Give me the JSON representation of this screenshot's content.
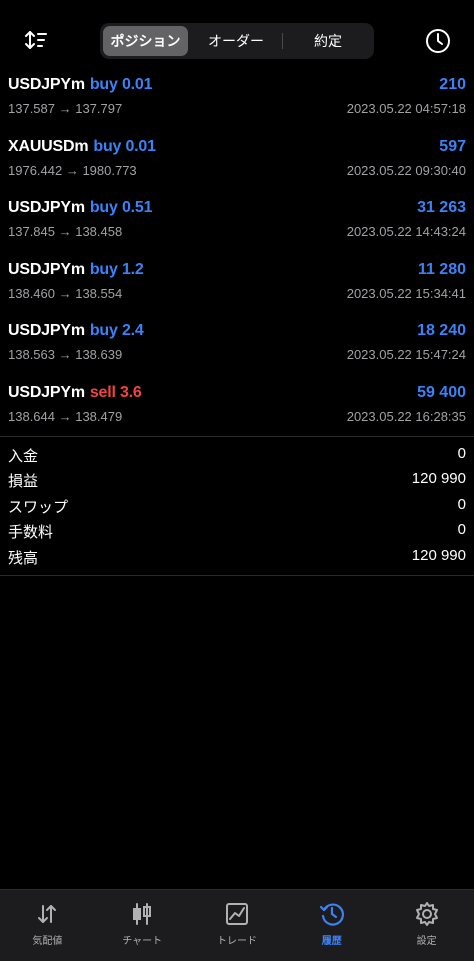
{
  "header": {
    "tabs": [
      {
        "label": "ポジション",
        "active": true
      },
      {
        "label": "オーダー",
        "active": false
      },
      {
        "label": "約定",
        "active": false
      }
    ],
    "sort_icon": "sort-arrows-icon",
    "history_icon": "clock-icon"
  },
  "deals": [
    {
      "symbol": "USDJPYm",
      "direction": "buy",
      "volume": "buy 0.01",
      "profit": "210",
      "prices": "137.587 → 137.797",
      "time": "2023.05.22 04:57:18"
    },
    {
      "symbol": "XAUUSDm",
      "direction": "buy",
      "volume": "buy 0.01",
      "profit": "597",
      "prices": "1976.442 → 1980.773",
      "time": "2023.05.22 09:30:40"
    },
    {
      "symbol": "USDJPYm",
      "direction": "buy",
      "volume": "buy 0.51",
      "profit": "31 263",
      "prices": "137.845 → 138.458",
      "time": "2023.05.22 14:43:24"
    },
    {
      "symbol": "USDJPYm",
      "direction": "buy",
      "volume": "buy 1.2",
      "profit": "11 280",
      "prices": "138.460 → 138.554",
      "time": "2023.05.22 15:34:41"
    },
    {
      "symbol": "USDJPYm",
      "direction": "buy",
      "volume": "buy 2.4",
      "profit": "18 240",
      "prices": "138.563 → 138.639",
      "time": "2023.05.22 15:47:24"
    },
    {
      "symbol": "USDJPYm",
      "direction": "sell",
      "volume": "sell 3.6",
      "profit": "59 400",
      "prices": "138.644 → 138.479",
      "time": "2023.05.22 16:28:35"
    }
  ],
  "summary": [
    {
      "label": "入金",
      "value": "0"
    },
    {
      "label": "損益",
      "value": "120 990"
    },
    {
      "label": "スワップ",
      "value": "0"
    },
    {
      "label": "手数料",
      "value": "0"
    },
    {
      "label": "残高",
      "value": "120 990"
    }
  ],
  "nav": [
    {
      "label": "気配値",
      "icon": "quotes-arrows-icon",
      "active": false
    },
    {
      "label": "チャート",
      "icon": "candlestick-chart-icon",
      "active": false
    },
    {
      "label": "トレード",
      "icon": "trade-chart-icon",
      "active": false
    },
    {
      "label": "履歴",
      "icon": "history-icon",
      "active": true
    },
    {
      "label": "設定",
      "icon": "gear-icon",
      "active": false
    }
  ],
  "colors": {
    "background": "#000000",
    "accent_blue": "#3b82f6",
    "sell_red": "#ef4444",
    "muted_text": "#a1a1a6"
  }
}
